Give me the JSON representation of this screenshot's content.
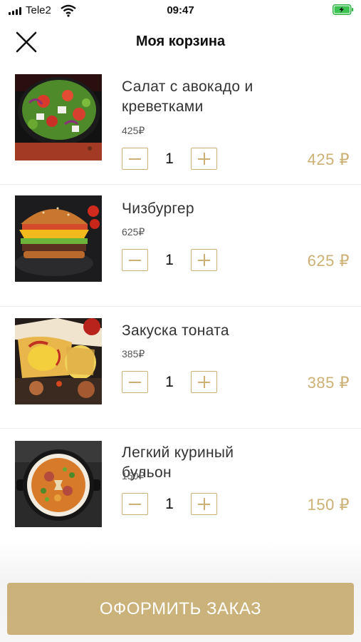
{
  "status_bar": {
    "carrier": "Tele2",
    "time": "09:47"
  },
  "header": {
    "title": "Моя корзина",
    "close_icon": "close-icon"
  },
  "accent_color": "#cdb074",
  "button_color": "#cbb27a",
  "items": [
    {
      "name": "Салат с авокадо и креветками",
      "unit_price": "425₽",
      "quantity": "1",
      "total": "425 ₽",
      "image": "salad-photo"
    },
    {
      "name": "Чизбургер",
      "unit_price": "625₽",
      "quantity": "1",
      "total": "625 ₽",
      "image": "cheeseburger-photo"
    },
    {
      "name": "Закуска тоната",
      "unit_price": "385₽",
      "quantity": "1",
      "total": "385 ₽",
      "image": "tonata-photo"
    },
    {
      "name": "Легкий куриный бульон",
      "unit_price": "150₽",
      "quantity": "1",
      "total": "150 ₽",
      "image": "chicken-soup-photo"
    }
  ],
  "checkout": {
    "label": "ОФОРМИТЬ ЗАКАЗ"
  }
}
